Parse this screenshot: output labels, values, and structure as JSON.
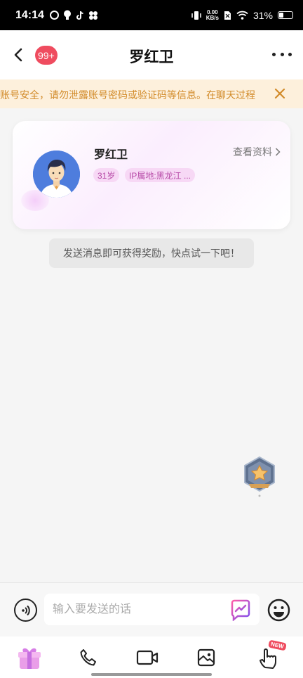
{
  "status_bar": {
    "time": "14:14",
    "network_speed_value": "0.00",
    "network_speed_unit": "KB/s",
    "battery_percent": "31%",
    "battery_level": 0.31
  },
  "header": {
    "unread_badge": "99+",
    "title": "罗红卫"
  },
  "notice": {
    "text": "账号安全，请勿泄露账号密码或验证码等信息。在聊天过程"
  },
  "profile_card": {
    "name": "罗红卫",
    "view_profile_label": "查看资料",
    "age_tag": "31岁",
    "ip_tag": "IP属地:黑龙江 ..."
  },
  "tip": {
    "text": "发送消息即可获得奖励，快点试一下吧！"
  },
  "input_bar": {
    "placeholder": "输入要发送的话"
  },
  "toolbar": {
    "new_badge": "NEW"
  },
  "colors": {
    "accent_pink": "#ef4c5f",
    "notice_bg": "#fdf0dc",
    "notice_text": "#d28b2a",
    "tag_bg": "#f7d8f5",
    "tag_text": "#b74aa7"
  },
  "icons": [
    "back-arrow-icon",
    "more-icon",
    "close-icon",
    "chevron-right-icon",
    "voice-icon",
    "ai-chat-icon",
    "emoji-icon",
    "gift-icon",
    "phone-icon",
    "video-icon",
    "photo-icon",
    "interact-hand-icon",
    "level-badge-icon"
  ]
}
